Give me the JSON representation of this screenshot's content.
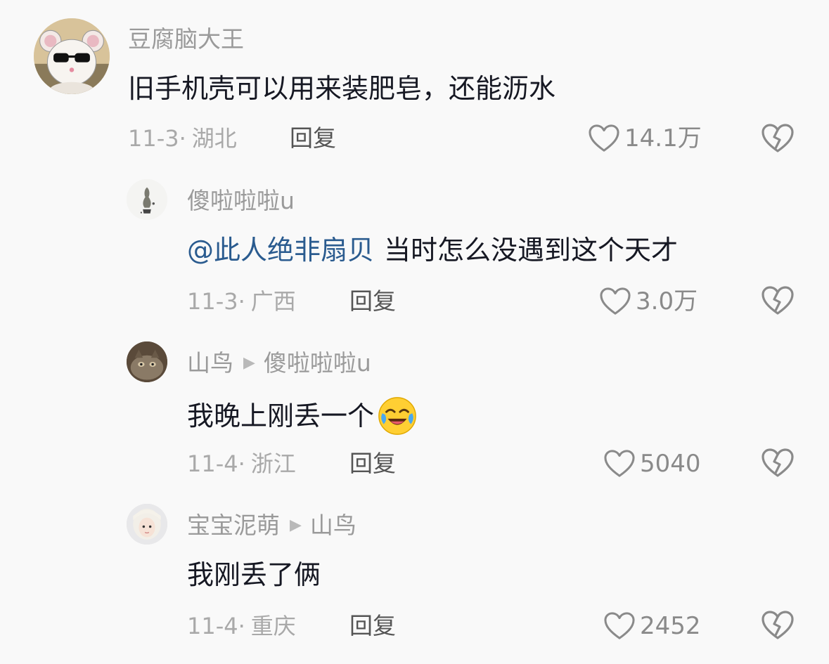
{
  "comments": [
    {
      "username": "豆腐脑大王",
      "reply_to": "",
      "text": "旧手机壳可以用来装肥皂，还能沥水",
      "mention": "",
      "date": "11-3",
      "location": "湖北",
      "reply_label": "回复",
      "likes": "14.1万"
    },
    {
      "username": "傻啦啦啦u",
      "reply_to": "",
      "mention": "@此人绝非扇贝",
      "text": "当时怎么没遇到这个天才",
      "date": "11-3",
      "location": "广西",
      "reply_label": "回复",
      "likes": "3.0万"
    },
    {
      "username": "山鸟",
      "reply_to": "傻啦啦啦u",
      "text": "我晚上刚丢一个",
      "mention": "",
      "date": "11-4",
      "location": "浙江",
      "reply_label": "回复",
      "likes": "5040"
    },
    {
      "username": "宝宝泥萌",
      "reply_to": "山鸟",
      "text": "我刚丢了俩",
      "mention": "",
      "date": "11-4",
      "location": "重庆",
      "reply_label": "回复",
      "likes": "2452"
    }
  ],
  "separator": "·",
  "reply_arrow": "▶",
  "icons": {
    "like": "heart-outline-icon",
    "dislike": "broken-heart-icon",
    "emoji": "crying-laughing-emoji"
  },
  "colors": {
    "mention": "#2a5b8f",
    "username": "#9a9a9a",
    "text": "#161823",
    "meta": "#a9a9a9"
  }
}
